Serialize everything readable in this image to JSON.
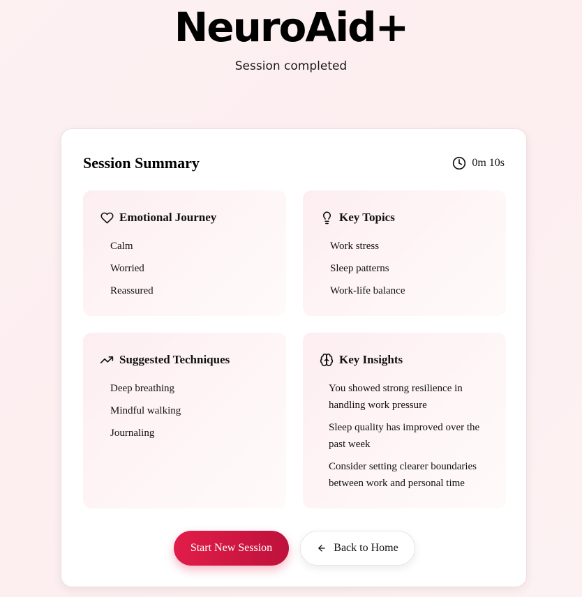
{
  "header": {
    "title": "NeuroAid+",
    "subtitle": "Session completed"
  },
  "summary": {
    "title": "Session Summary",
    "duration": "0m 10s",
    "duration_icon": "clock-icon"
  },
  "panels": {
    "emotional_journey": {
      "title": "Emotional Journey",
      "icon": "heart-icon",
      "items": [
        "Calm",
        "Worried",
        "Reassured"
      ]
    },
    "key_topics": {
      "title": "Key Topics",
      "icon": "lightbulb-icon",
      "items": [
        "Work stress",
        "Sleep patterns",
        "Work-life balance"
      ]
    },
    "suggested_techniques": {
      "title": "Suggested Techniques",
      "icon": "trending-up-icon",
      "items": [
        "Deep breathing",
        "Mindful walking",
        "Journaling"
      ]
    },
    "key_insights": {
      "title": "Key Insights",
      "icon": "brain-icon",
      "items": [
        "You showed strong resilience in handling work pressure",
        "Sleep quality has improved over the past week",
        "Consider setting clearer boundaries between work and personal time"
      ]
    }
  },
  "actions": {
    "start_new_session": "Start New Session",
    "back_to_home": "Back to Home",
    "back_icon": "arrow-left-icon"
  },
  "colors": {
    "accent_start": "#e11d48",
    "accent_end": "#be123c",
    "panel_tint": "#fdeef1",
    "background": "#fdf1f2"
  }
}
